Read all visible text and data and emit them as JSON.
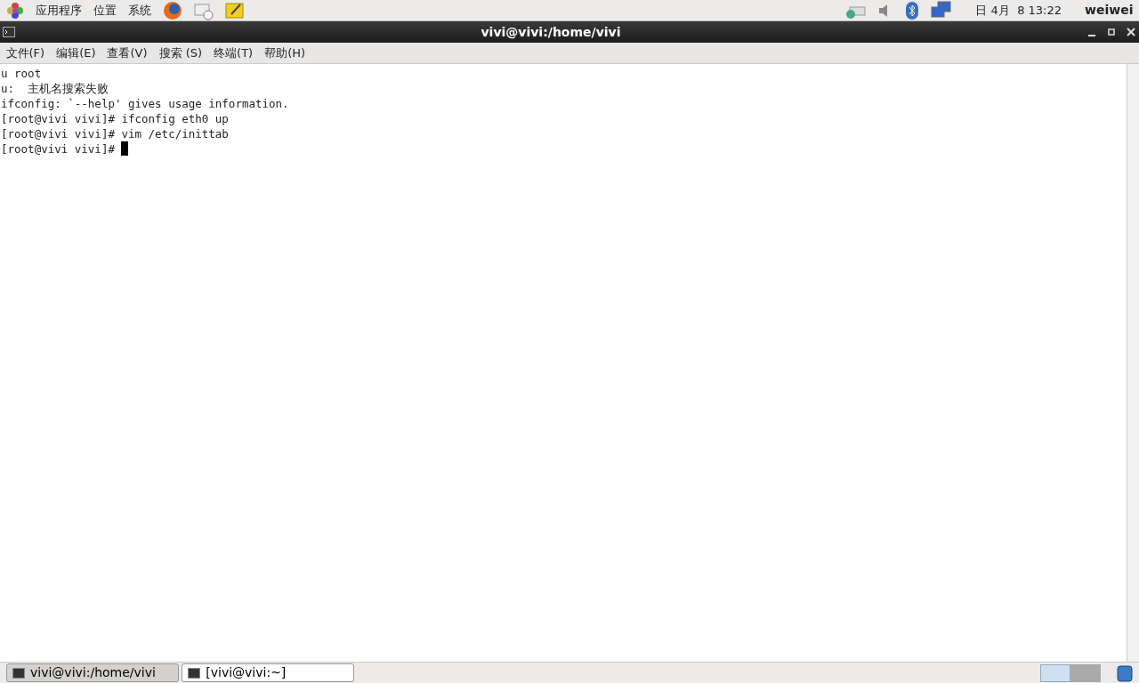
{
  "top_panel": {
    "menus": [
      "应用程序",
      "位置",
      "系统"
    ],
    "clock": "日 4月  8 13:22",
    "user": "weiwei"
  },
  "window": {
    "title": "vivi@vivi:/home/vivi"
  },
  "menu_bar": [
    "文件(F)",
    "编辑(E)",
    "查看(V)",
    "搜索 (S)",
    "终端(T)",
    "帮助(H)"
  ],
  "terminal": {
    "lines": [
      "u root",
      "u:  主机名搜索失败",
      "ifconfig: `--help' gives usage information.",
      "[root@vivi vivi]# ifconfig eth0 up",
      "[root@vivi vivi]# vim /etc/inittab",
      "[root@vivi vivi]# "
    ]
  },
  "taskbar": {
    "tasks": [
      {
        "label": "vivi@vivi:/home/vivi",
        "selected": true
      },
      {
        "label": "[vivi@vivi:~]",
        "selected": false
      }
    ],
    "workspaces": [
      {
        "selected": true
      },
      {
        "selected": false
      }
    ]
  }
}
